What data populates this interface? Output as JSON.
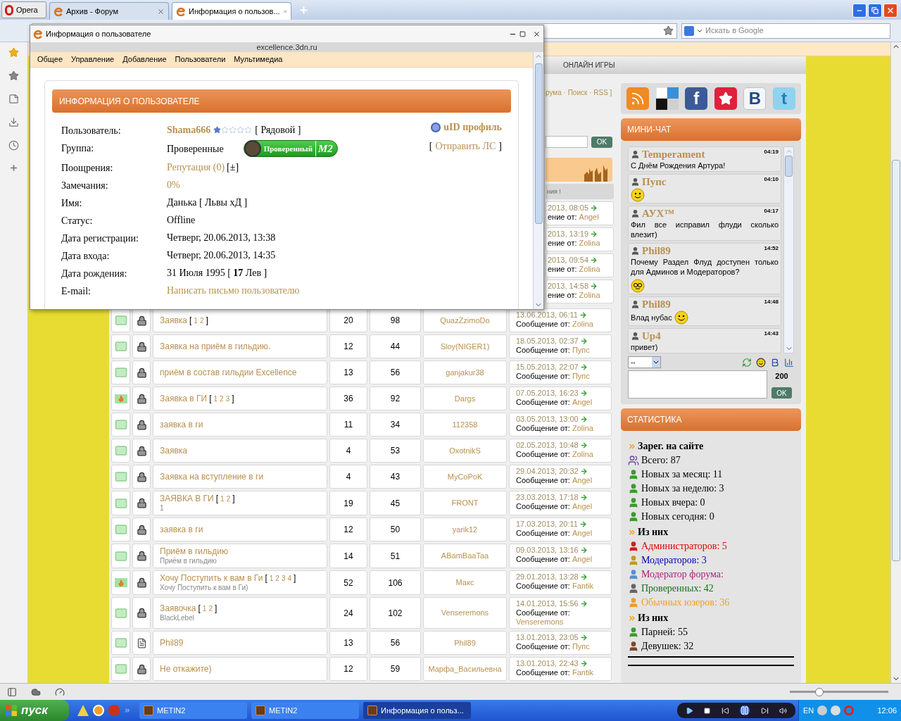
{
  "browser": {
    "menu_label": "Opera",
    "tabs": [
      {
        "label": "Архив - Форум",
        "selected": false
      },
      {
        "label": "Информация о пользов...",
        "selected": true
      }
    ],
    "search": {
      "placeholder": "Искать в Google"
    },
    "zoom": {
      "level": 0.3
    }
  },
  "site": {
    "nav_item": "ОНЛАЙН ИГРЫ",
    "nav_fragment": "рума · Поиск · RSS ]",
    "search_button": "OK",
    "greeting_fragment": "ния !",
    "partial_rows": [
      {
        "date": "2013, 08:05",
        "by_label": "ение от:",
        "by": "Angel"
      },
      {
        "date": "2013, 13:19",
        "by_label": "ение от:",
        "by": "Zolina"
      },
      {
        "date": "2013, 09:54",
        "by_label": "ение от:",
        "by": "Zolina"
      },
      {
        "date": "2013, 14:58",
        "by_label": "ение от:",
        "by": "Zolina"
      }
    ],
    "topics": [
      {
        "kind": "mail-lock",
        "title": "Заявка",
        "pages": {
          "open": "[",
          "items": [
            "1",
            "2"
          ],
          "close": "]"
        },
        "replies": "20",
        "views": "98",
        "author": "QuazZzimoDo",
        "date": "13.06.2013, 06:11",
        "by_label": "Сообщение от:",
        "by": "Zolina"
      },
      {
        "kind": "mail-lock",
        "title": "Заявка на приём в гильдию.",
        "replies": "12",
        "views": "44",
        "author": "Sloy(NIGER1)",
        "date": "18.05.2013, 02:37",
        "by_label": "Сообщение от:",
        "by": "Пупс"
      },
      {
        "kind": "mail-lock",
        "title": "приём в состав гильдии Excellence",
        "replies": "13",
        "views": "56",
        "author": "ganjakur38",
        "date": "15.05.2013, 22:07",
        "by_label": "Сообщение от:",
        "by": "Пупс"
      },
      {
        "kind": "hot-lock",
        "title": "Заявка в ГИ",
        "pages": {
          "open": "[",
          "items": [
            "1",
            "2",
            "3"
          ],
          "close": "]"
        },
        "replies": "36",
        "views": "92",
        "author": "Dargs",
        "date": "07.05.2013, 16:23",
        "by_label": "Сообщение от:",
        "by": "Angel"
      },
      {
        "kind": "mail-lock",
        "title": "заявка в ги",
        "replies": "11",
        "views": "34",
        "author": "112358",
        "date": "03.05.2013, 13:00",
        "by_label": "Сообщение от:",
        "by": "Zolina"
      },
      {
        "kind": "mail-lock",
        "title": "Заявка",
        "replies": "4",
        "views": "53",
        "author": "OxotnikS",
        "date": "02.05.2013, 10:48",
        "by_label": "Сообщение от:",
        "by": "Zolina"
      },
      {
        "kind": "mail-lock",
        "title": "Заявка на вступление в ги",
        "replies": "4",
        "views": "43",
        "author": "MyCoPoK",
        "date": "29.04.2013, 20:32",
        "by_label": "Сообщение от:",
        "by": "Angel"
      },
      {
        "kind": "mail-lock",
        "title": "ЗАЯВКА В ГИ",
        "pages": {
          "open": "[",
          "items": [
            "1",
            "2"
          ],
          "close": "]"
        },
        "subtitle": "1",
        "replies": "19",
        "views": "45",
        "author": "FRONT",
        "date": "23.03.2013, 17:18",
        "by_label": "Сообщение от:",
        "by": "Angel"
      },
      {
        "kind": "mail-lock",
        "title": "заявка в ги",
        "replies": "12",
        "views": "50",
        "author": "yarik12",
        "date": "17.03.2013, 20:11",
        "by_label": "Сообщение от:",
        "by": "Angel"
      },
      {
        "kind": "mail-lock",
        "title": "Приём в гильдию",
        "subtitle": "Приём в гильдию",
        "replies": "14",
        "views": "51",
        "author": "ABamBaaTaa",
        "date": "09.03.2013, 13:16",
        "by_label": "Сообщение от:",
        "by": "Angel"
      },
      {
        "kind": "hot-lock",
        "title": "Хочу Поступить к вам в Ги",
        "pages": {
          "open": "[",
          "items": [
            "1",
            "2",
            "3",
            "4"
          ],
          "close": "]"
        },
        "subtitle": "Хочу Поступить к вам в Ги)",
        "replies": "52",
        "views": "106",
        "author": "Макс",
        "date": "29.01.2013, 13:28",
        "by_label": "Сообщение от:",
        "by": "Fantik"
      },
      {
        "kind": "mail-lock",
        "title": "Заявочка",
        "pages": {
          "open": "[",
          "items": [
            "1",
            "2"
          ],
          "close": "]"
        },
        "subtitle": "BlackLebel",
        "replies": "24",
        "views": "102",
        "author": "Venseremons",
        "date": "14.01.2013, 15:56",
        "by_label": "Сообщение от:",
        "by": "Venseremons"
      },
      {
        "kind": "mail-doc",
        "title": "Phil89",
        "replies": "13",
        "views": "56",
        "author": "Phil89",
        "date": "13.01.2013, 23:05",
        "by_label": "Сообщение от:",
        "by": "Пупс"
      },
      {
        "kind": "mail-lock",
        "title": "Не откажите)",
        "replies": "12",
        "views": "59",
        "author": "Марфа_Васильевна",
        "date": "13.01.2013, 22:43",
        "by_label": "Сообщение от:",
        "by": "Fantik"
      }
    ],
    "social": [
      {
        "kind": "rss"
      },
      {
        "kind": "squares"
      },
      {
        "kind": "facebook",
        "glyph": "f"
      },
      {
        "kind": "star"
      },
      {
        "kind": "vk",
        "glyph": "B"
      },
      {
        "kind": "twitter",
        "glyph": "t"
      }
    ],
    "chat": {
      "title": "МИНИ-ЧАТ",
      "messages": [
        {
          "kind": "plain",
          "user": "Temperament",
          "time": "04:19",
          "text": "С Днём Рождения Артура!"
        },
        {
          "kind": "wave",
          "user": "Пупс",
          "time": "04:10"
        },
        {
          "kind": "plain",
          "user": "АУХ™",
          "time": "04:17",
          "text": "Фил все исправил флуди сколько влезит)"
        },
        {
          "kind": "cool",
          "user": "Phil89",
          "time": "14:52",
          "text": "Почему Раздел Флуд доступен только для Админов и Модераторов?"
        },
        {
          "kind": "smile",
          "user": "Phil89",
          "time": "14:48",
          "text": "Влад нубас"
        },
        {
          "kind": "plain",
          "user": "Up4",
          "time": "14:43",
          "text": "привет)"
        }
      ],
      "select_value": "--",
      "counter": "200",
      "send_button": "OK"
    },
    "stats": {
      "title": "СТАТИСТИКА",
      "sections": [
        {
          "heading": "Зарег. на сайте",
          "items": [
            {
              "kind": "group",
              "text": "Всего: 87",
              "color": "#000000"
            },
            {
              "kind": "male",
              "text": "Новых за месяц: 11",
              "color": "#000000"
            },
            {
              "kind": "male",
              "text": "Новых за неделю: 3",
              "color": "#000000"
            },
            {
              "kind": "male",
              "text": "Новых вчера: 0",
              "color": "#000000"
            },
            {
              "kind": "male",
              "text": "Новых сегодня: 0",
              "color": "#000000"
            }
          ]
        },
        {
          "heading": "Из них",
          "items": [
            {
              "kind": "admin",
              "text": "Администраторов: 5",
              "color": "#e00000"
            },
            {
              "kind": "moderator",
              "text": "Модераторов: 3",
              "color": "#0000b0"
            },
            {
              "kind": "forummod",
              "text": "Модератор форума:",
              "color": "#b0207a"
            },
            {
              "kind": "verified",
              "text": "Проверенных: 42",
              "color": "#1d6b1d"
            },
            {
              "kind": "regular",
              "text": "Обычных юзеров: 36",
              "color": "#f0a020"
            }
          ]
        },
        {
          "heading": "Из них",
          "items": [
            {
              "kind": "male",
              "text": "Парней: 55",
              "color": "#000000"
            },
            {
              "kind": "female",
              "text": "Девушек: 32",
              "color": "#000000"
            }
          ]
        }
      ]
    }
  },
  "popup": {
    "title": "Информация о пользователе",
    "address": "excellence.3dn.ru",
    "menu": [
      "Общее",
      "Управление",
      "Добавление",
      "Пользователи",
      "Мультимедиа"
    ],
    "header": "ИНФОРМАЦИЯ О ПОЛЬЗОВАТЕЛЕ",
    "uid_link": "uID профиль",
    "pm_link": {
      "open": "[",
      "label": "Отправить ЛС",
      "close": "]"
    },
    "rows": [
      {
        "kind": "user",
        "label": "Пользователь:",
        "value": "Shama666",
        "stars": 1,
        "rank": "[ Рядовой ]"
      },
      {
        "kind": "group",
        "label": "Группа:",
        "value": "Проверенные",
        "badge": "Проверенный",
        "badge_tag": "M2"
      },
      {
        "kind": "reputation",
        "label": "Поощрения:",
        "value": "Репутация (0)",
        "extra": "[±]"
      },
      {
        "kind": "link",
        "label": "Замечания:",
        "value": "0%"
      },
      {
        "kind": "text",
        "label": "Имя:",
        "value": "Данька [ Львы хД ]"
      },
      {
        "kind": "text",
        "label": "Статус:",
        "value": "Offline"
      },
      {
        "kind": "text",
        "label": "Дата регистрации:",
        "value": "Четверг, 20.06.2013, 13:38"
      },
      {
        "kind": "text",
        "label": "Дата входа:",
        "value": "Четверг, 20.06.2013, 14:35"
      },
      {
        "kind": "text",
        "label": "Дата рождения:",
        "value": "31 Июля 1995 [ **17** Лев ]"
      },
      {
        "kind": "link",
        "label": "E-mail:",
        "value": "Написать письмо пользователю"
      }
    ]
  },
  "taskbar": {
    "start": "пуск",
    "tasks": [
      {
        "label": "METIN2",
        "selected": false
      },
      {
        "label": "METIN2",
        "selected": false
      },
      {
        "label": "Информация о польз...",
        "selected": true
      }
    ],
    "lang": "EN",
    "clock": "12:06"
  }
}
